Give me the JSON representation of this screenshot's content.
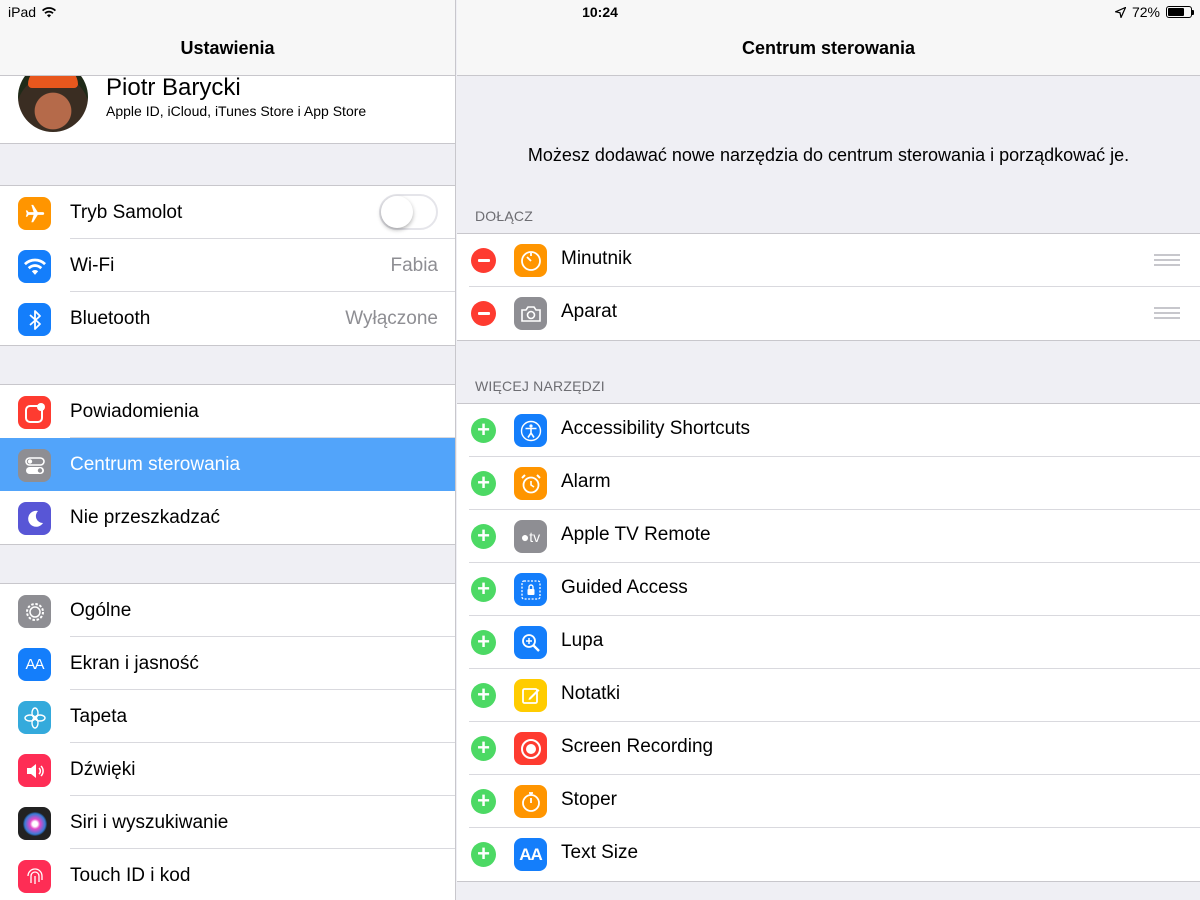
{
  "status": {
    "device": "iPad",
    "time": "10:24",
    "battery": "72%",
    "battery_level": 0.72
  },
  "left": {
    "title": "Ustawienia",
    "profile": {
      "name": "Piotr Barycki",
      "subtitle": "Apple ID, iCloud, iTunes Store i App Store"
    },
    "group1": [
      {
        "label": "Tryb Samolot",
        "icon": "airplane-icon",
        "color": "#ff9500",
        "toggle": false
      },
      {
        "label": "Wi-Fi",
        "icon": "wifi-icon",
        "color": "#147efb",
        "value": "Fabia"
      },
      {
        "label": "Bluetooth",
        "icon": "bluetooth-icon",
        "color": "#147efb",
        "value": "Wyłączone"
      }
    ],
    "group2": [
      {
        "label": "Powiadomienia",
        "icon": "notifications-icon",
        "color": "#fe3b30"
      },
      {
        "label": "Centrum sterowania",
        "icon": "control-center-icon",
        "color": "#8e8e93",
        "selected": true
      },
      {
        "label": "Nie przeszkadzać",
        "icon": "moon-icon",
        "color": "#5856d6"
      }
    ],
    "group3": [
      {
        "label": "Ogólne",
        "icon": "gear-icon",
        "color": "#8e8e93"
      },
      {
        "label": "Ekran i jasność",
        "icon": "display-icon",
        "color": "#147efb",
        "glyph": "AA"
      },
      {
        "label": "Tapeta",
        "icon": "wallpaper-icon",
        "color": "#34aadc"
      },
      {
        "label": "Dźwięki",
        "icon": "speaker-icon",
        "color": "#fe2d55"
      },
      {
        "label": "Siri i wyszukiwanie",
        "icon": "siri-icon",
        "color": "#222222"
      },
      {
        "label": "Touch ID i kod",
        "icon": "fingerprint-icon",
        "color": "#fe2d55"
      }
    ]
  },
  "right": {
    "title": "Centrum sterowania",
    "intro": "Możesz dodawać nowe narzędzia do centrum sterowania i porządkować je.",
    "include_header": "DOŁĄCZ",
    "include": [
      {
        "label": "Minutnik",
        "icon": "timer-icon",
        "color": "#ff9500"
      },
      {
        "label": "Aparat",
        "icon": "camera-icon",
        "color": "#8e8e93"
      }
    ],
    "more_header": "WIĘCEJ NARZĘDZI",
    "more": [
      {
        "label": "Accessibility Shortcuts",
        "icon": "accessibility-icon",
        "color": "#147efb"
      },
      {
        "label": "Alarm",
        "icon": "alarm-icon",
        "color": "#ff9500"
      },
      {
        "label": "Apple TV Remote",
        "icon": "apple-tv-icon",
        "color": "#8e8e93",
        "glyph": "tv"
      },
      {
        "label": "Guided Access",
        "icon": "guided-access-icon",
        "color": "#147efb"
      },
      {
        "label": "Lupa",
        "icon": "magnifier-icon",
        "color": "#147efb"
      },
      {
        "label": "Notatki",
        "icon": "notes-icon",
        "color": "#ffcc00"
      },
      {
        "label": "Screen Recording",
        "icon": "screen-recording-icon",
        "color": "#fe3b30"
      },
      {
        "label": "Stoper",
        "icon": "stopwatch-icon",
        "color": "#ff9500"
      },
      {
        "label": "Text Size",
        "icon": "text-size-icon",
        "color": "#147efb",
        "glyph": "AA"
      }
    ]
  }
}
